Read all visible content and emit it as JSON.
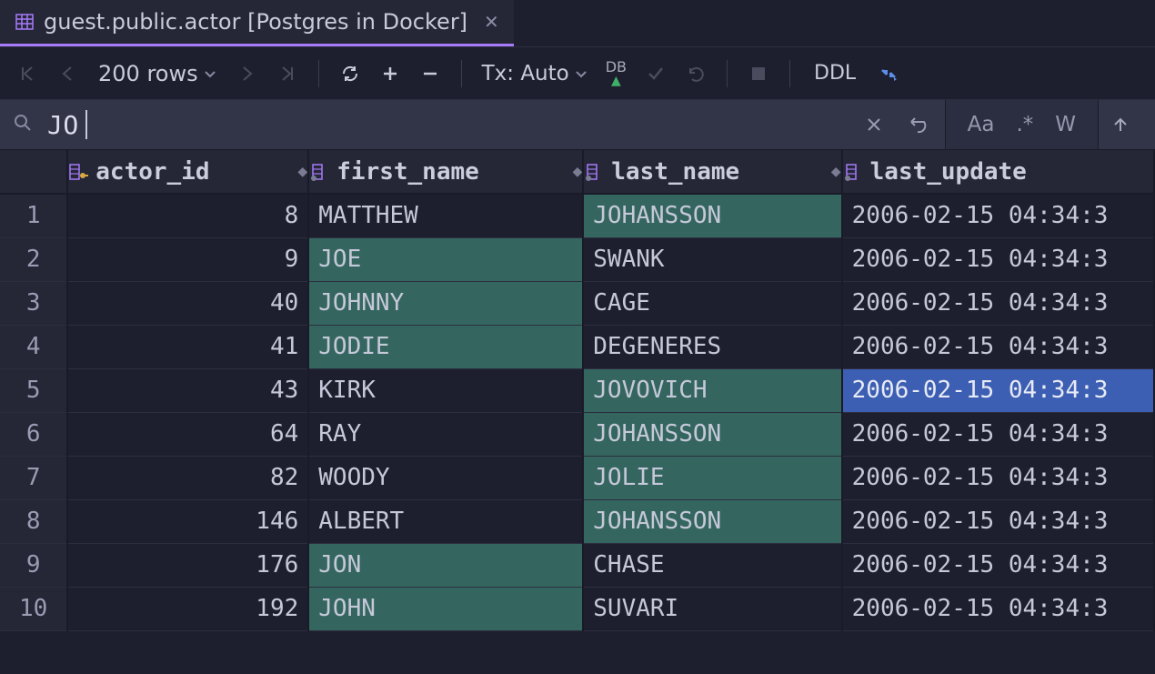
{
  "tab": {
    "title": "guest.public.actor [Postgres in Docker]"
  },
  "toolbar": {
    "rows_label": "200 rows",
    "tx_label": "Tx: Auto",
    "db_label": "DB",
    "ddl_label": "DDL"
  },
  "search": {
    "value": "JO",
    "opt_case": "Aa",
    "opt_regex": ".*",
    "opt_words": "W"
  },
  "columns": [
    {
      "name": "actor_id",
      "pk": true,
      "sortable": true
    },
    {
      "name": "first_name",
      "pk": false,
      "sortable": true
    },
    {
      "name": "last_name",
      "pk": false,
      "sortable": true
    },
    {
      "name": "last_update",
      "pk": false,
      "sortable": false
    }
  ],
  "rows": [
    {
      "n": 1,
      "actor_id": 8,
      "first_name": "MATTHEW",
      "last_name": "JOHANSSON",
      "last_update": "2006-02-15 04:34:3",
      "hl_first": false,
      "hl_last": true,
      "sel": false
    },
    {
      "n": 2,
      "actor_id": 9,
      "first_name": "JOE",
      "last_name": "SWANK",
      "last_update": "2006-02-15 04:34:3",
      "hl_first": true,
      "hl_last": false,
      "sel": false
    },
    {
      "n": 3,
      "actor_id": 40,
      "first_name": "JOHNNY",
      "last_name": "CAGE",
      "last_update": "2006-02-15 04:34:3",
      "hl_first": true,
      "hl_last": false,
      "sel": false
    },
    {
      "n": 4,
      "actor_id": 41,
      "first_name": "JODIE",
      "last_name": "DEGENERES",
      "last_update": "2006-02-15 04:34:3",
      "hl_first": true,
      "hl_last": false,
      "sel": false
    },
    {
      "n": 5,
      "actor_id": 43,
      "first_name": "KIRK",
      "last_name": "JOVOVICH",
      "last_update": "2006-02-15 04:34:3",
      "hl_first": false,
      "hl_last": true,
      "sel": true
    },
    {
      "n": 6,
      "actor_id": 64,
      "first_name": "RAY",
      "last_name": "JOHANSSON",
      "last_update": "2006-02-15 04:34:3",
      "hl_first": false,
      "hl_last": true,
      "sel": false
    },
    {
      "n": 7,
      "actor_id": 82,
      "first_name": "WOODY",
      "last_name": "JOLIE",
      "last_update": "2006-02-15 04:34:3",
      "hl_first": false,
      "hl_last": true,
      "sel": false
    },
    {
      "n": 8,
      "actor_id": 146,
      "first_name": "ALBERT",
      "last_name": "JOHANSSON",
      "last_update": "2006-02-15 04:34:3",
      "hl_first": false,
      "hl_last": true,
      "sel": false
    },
    {
      "n": 9,
      "actor_id": 176,
      "first_name": "JON",
      "last_name": "CHASE",
      "last_update": "2006-02-15 04:34:3",
      "hl_first": true,
      "hl_last": false,
      "sel": false
    },
    {
      "n": 10,
      "actor_id": 192,
      "first_name": "JOHN",
      "last_name": "SUVARI",
      "last_update": "2006-02-15 04:34:3",
      "hl_first": true,
      "hl_last": false,
      "sel": false
    }
  ]
}
